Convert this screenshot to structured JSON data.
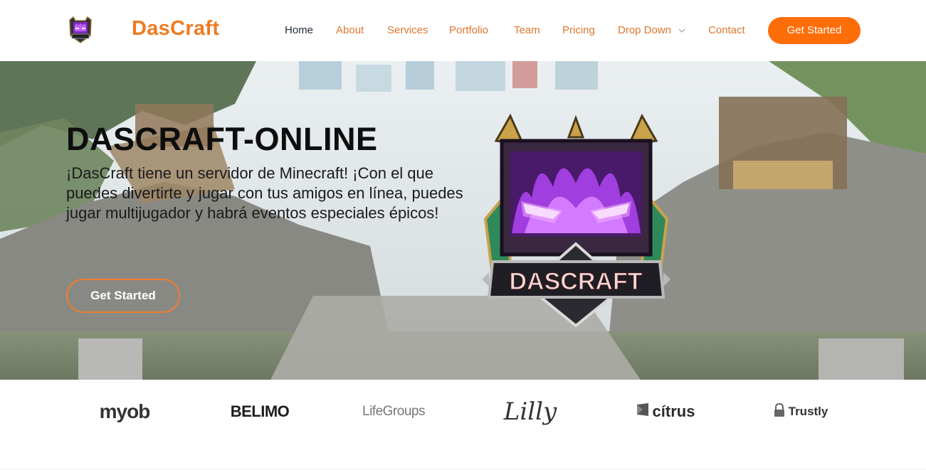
{
  "header": {
    "brand": "DasCraft",
    "nav": [
      {
        "label": "Home",
        "active": true
      },
      {
        "label": "About"
      },
      {
        "label": "Services"
      },
      {
        "label": "Portfolio"
      },
      {
        "label": "Team"
      },
      {
        "label": "Pricing"
      },
      {
        "label": "Drop Down",
        "has_dropdown": true
      },
      {
        "label": "Contact"
      }
    ],
    "cta_label": "Get Started"
  },
  "hero": {
    "title": "DASCRAFT-ONLINE",
    "description": "¡DasCraft tiene un servidor de Minecraft! ¡Con el que puedes divertirte y jugar con tus amigos en línea, puedes jugar multijugador y habrá eventos especiales épicos!",
    "cta_label": "Get Started",
    "emblem_text": "DASCRAFT"
  },
  "clients": [
    {
      "name": "myob"
    },
    {
      "name": "BELIMO"
    },
    {
      "name": "LifeGroups"
    },
    {
      "name": "Lilly"
    },
    {
      "name": "cítrus"
    },
    {
      "name": "Trustly"
    }
  ],
  "colors": {
    "accent": "#fd6d08",
    "nav_text": "#e0772f",
    "nav_active": "#1f2a3a"
  }
}
